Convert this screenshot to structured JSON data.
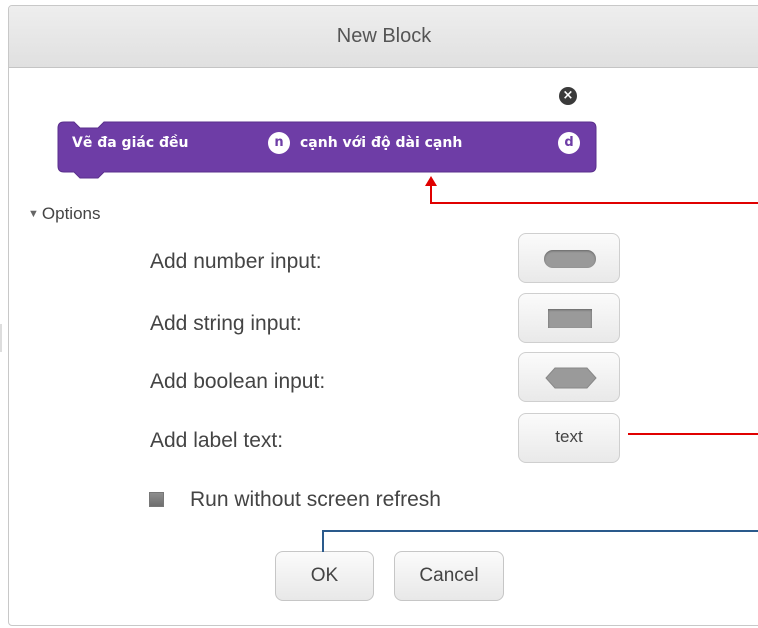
{
  "dialog": {
    "title": "New Block",
    "close_icon": "close-icon"
  },
  "block": {
    "color": "#6e3da6",
    "text_1": "Vẽ đa giác đều",
    "arg_1": "n",
    "text_2": "cạnh với độ dài cạnh",
    "arg_2": "d"
  },
  "options": {
    "toggle_label": "Options",
    "toggle_icon": "triangle-down-icon",
    "rows": [
      {
        "label": "Add number input:",
        "button_icon": "rounded-slot-icon"
      },
      {
        "label": "Add string input:",
        "button_icon": "rect-slot-icon"
      },
      {
        "label": "Add boolean input:",
        "button_icon": "hexagon-slot-icon"
      },
      {
        "label": "Add label text:",
        "button_label": "text"
      }
    ],
    "checkbox_label": "Run without screen refresh"
  },
  "buttons": {
    "ok": "OK",
    "cancel": "Cancel"
  },
  "annotation_colors": {
    "red": "#e00000",
    "blue": "#2a5a8c"
  }
}
